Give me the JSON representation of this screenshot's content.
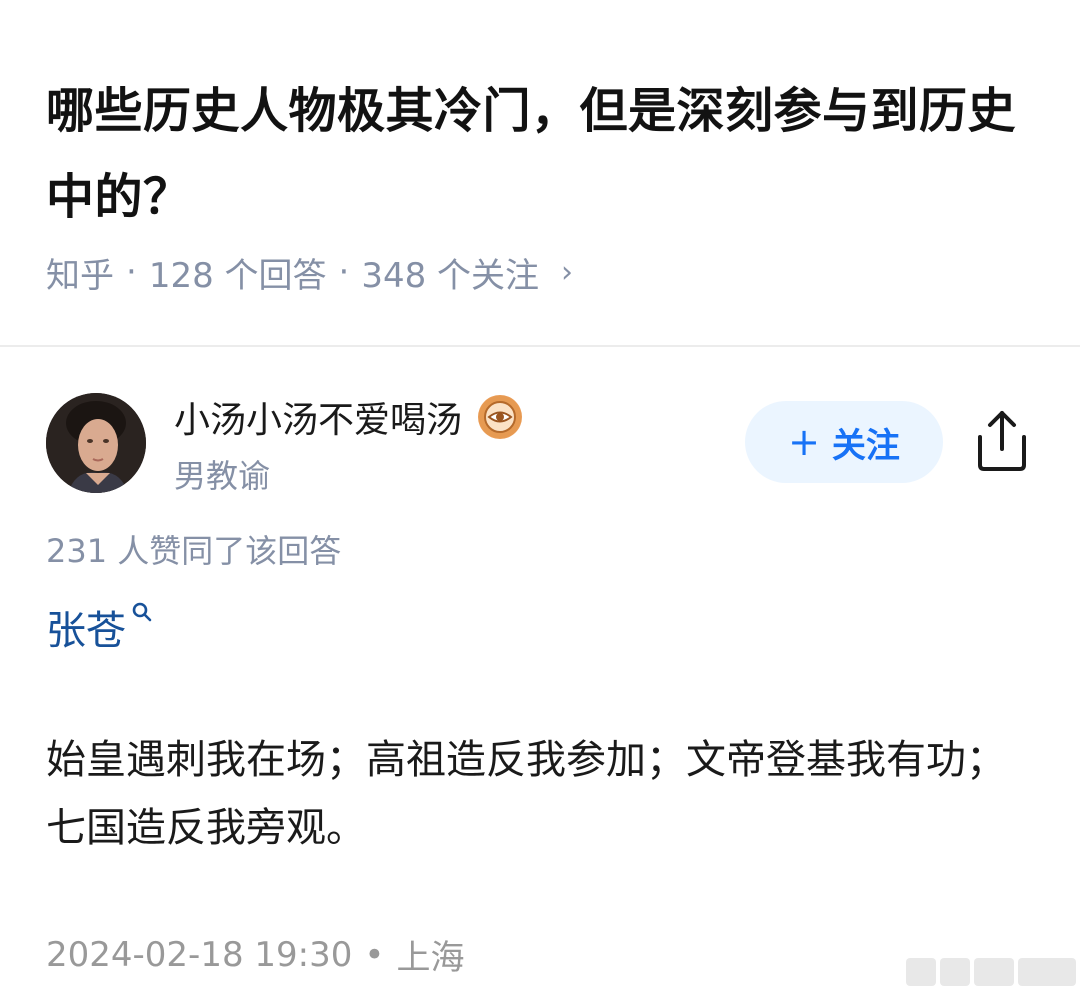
{
  "question": {
    "title": "哪些历史人物极其冷门，但是深刻参与到历史中的？",
    "source": "知乎",
    "dot": "·",
    "answers": "128 个回答",
    "followers": "348 个关注",
    "chevron": "›"
  },
  "author": {
    "name": "小汤小汤不爱喝汤",
    "bio": "男教谕",
    "badge_icon": "eye-badge-icon",
    "follow_plus": "+",
    "follow_label": "关注",
    "share_icon": "share-icon"
  },
  "answer": {
    "likes": "231 人赞同了该回答",
    "topic_link": "张苍",
    "content": "始皇遇刺我在场；高祖造反我参加；文帝登基我有功；七国造反我旁观。",
    "date": "2024-02-18 19:30",
    "sep": "•",
    "location": "上海"
  },
  "colors": {
    "accent": "#1772f6",
    "follow_bg": "#ebf5ff",
    "link": "#175199",
    "meta": "#8590a6",
    "badge": "#ea9c55"
  }
}
